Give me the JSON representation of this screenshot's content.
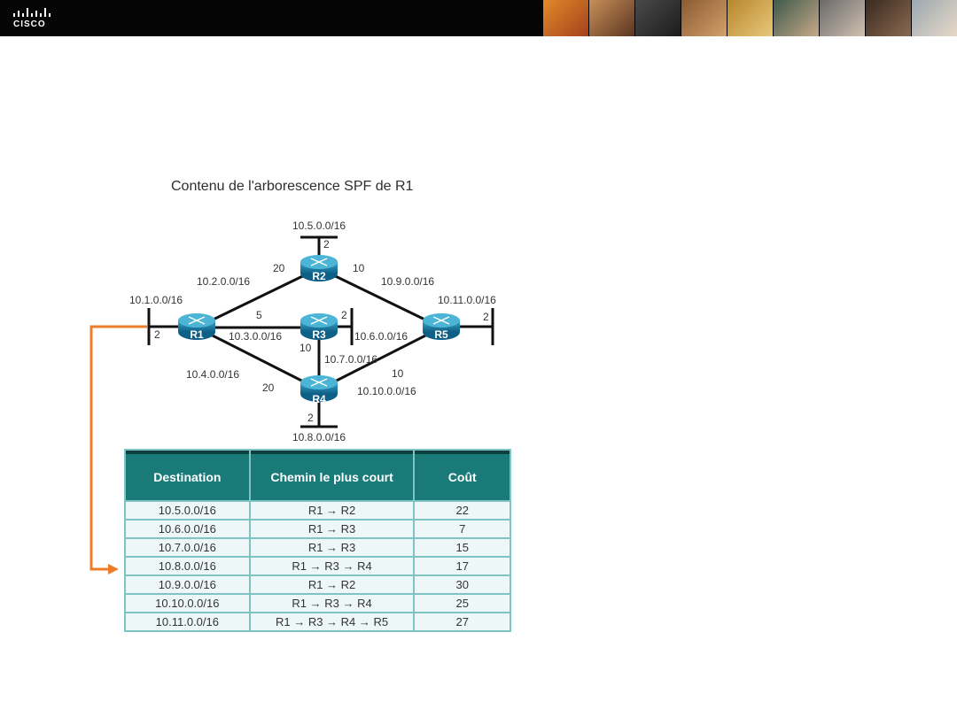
{
  "header": {
    "brand": "CISCO",
    "photos": [
      "photo-1",
      "photo-2",
      "photo-3",
      "photo-4",
      "photo-5",
      "photo-6",
      "photo-7",
      "photo-8",
      "photo-9"
    ],
    "colors": {
      "bar": "#050505",
      "accent": "#ee7d2b",
      "table_header": "#1a7a78"
    }
  },
  "diagram": {
    "title": "Contenu de l'arborescence SPF de R1",
    "routers": [
      {
        "id": "R1",
        "label": "R1"
      },
      {
        "id": "R2",
        "label": "R2"
      },
      {
        "id": "R3",
        "label": "R3"
      },
      {
        "id": "R4",
        "label": "R4"
      },
      {
        "id": "R5",
        "label": "R5"
      }
    ],
    "networks": {
      "n1": "10.1.0.0/16",
      "n2": "10.2.0.0/16",
      "n3": "10.3.0.0/16",
      "n4": "10.4.0.0/16",
      "n5": "10.5.0.0/16",
      "n6": "10.6.0.0/16",
      "n7": "10.7.0.0/16",
      "n8": "10.8.0.0/16",
      "n9": "10.9.0.0/16",
      "n10": "10.10.0.0/16",
      "n11": "10.11.0.0/16"
    },
    "costs": {
      "r1_lan": "2",
      "r2_lan": "2",
      "r3_lan": "2",
      "r4_lan": "2",
      "r5_lan": "2",
      "r1_r2": "20",
      "r2_r5": "10",
      "r1_r3": "5",
      "r3_r4": "10",
      "r1_r4": "20",
      "r4_r5": "10"
    }
  },
  "table": {
    "headers": [
      "Destination",
      "Chemin le plus court",
      "Coût"
    ],
    "rows": [
      [
        "10.5.0.0/16",
        "R1 → R2",
        "22"
      ],
      [
        "10.6.0.0/16",
        "R1 → R3",
        "7"
      ],
      [
        "10.7.0.0/16",
        "R1 → R3",
        "15"
      ],
      [
        "10.8.0.0/16",
        "R1 → R3 → R4",
        "17"
      ],
      [
        "10.9.0.0/16",
        "R1 → R2",
        "30"
      ],
      [
        "10.10.0.0/16",
        "R1 → R3 → R4",
        "25"
      ],
      [
        "10.11.0.0/16",
        "R1 → R3 → R4 → R5",
        "27"
      ]
    ]
  }
}
